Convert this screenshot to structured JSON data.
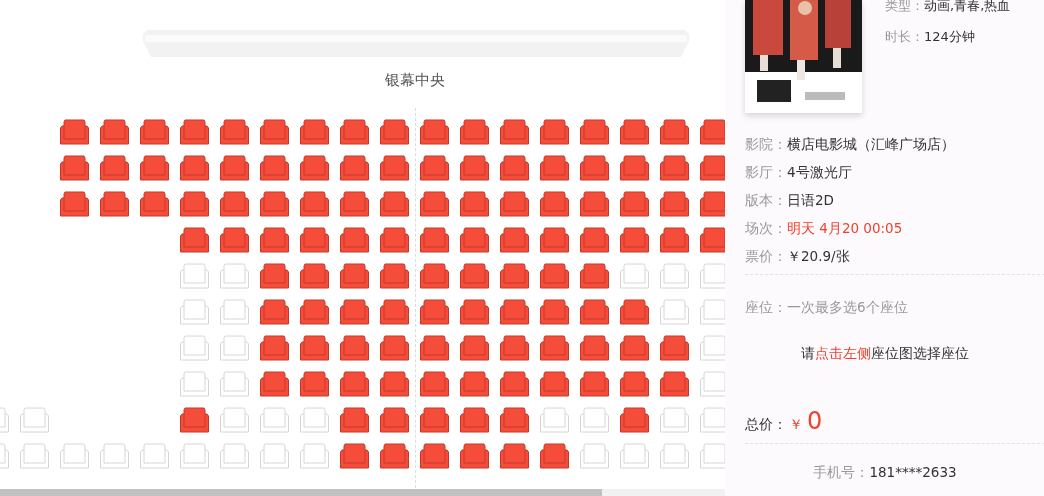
{
  "hall": {
    "screen_label": "银幕中央",
    "rows": [
      {
        "seats": [
          {
            "kind": "gap"
          },
          {
            "kind": "gap"
          },
          {
            "kind": "seat",
            "sold": true
          },
          {
            "kind": "seat",
            "sold": true
          },
          {
            "kind": "seat",
            "sold": true
          },
          {
            "kind": "seat",
            "sold": true
          },
          {
            "kind": "seat",
            "sold": true
          },
          {
            "kind": "seat",
            "sold": true
          },
          {
            "kind": "seat",
            "sold": true
          },
          {
            "kind": "seat",
            "sold": true
          },
          {
            "kind": "seat",
            "sold": true
          },
          {
            "kind": "seat",
            "sold": true
          },
          {
            "kind": "seat",
            "sold": true
          },
          {
            "kind": "seat",
            "sold": true
          },
          {
            "kind": "seat",
            "sold": true
          },
          {
            "kind": "seat",
            "sold": true
          },
          {
            "kind": "seat",
            "sold": true
          },
          {
            "kind": "seat",
            "sold": true
          },
          {
            "kind": "seat",
            "sold": true
          }
        ]
      },
      {
        "seats": [
          {
            "kind": "gap"
          },
          {
            "kind": "gap"
          },
          {
            "kind": "seat",
            "sold": true
          },
          {
            "kind": "seat",
            "sold": true
          },
          {
            "kind": "seat",
            "sold": true
          },
          {
            "kind": "seat",
            "sold": true
          },
          {
            "kind": "seat",
            "sold": true
          },
          {
            "kind": "seat",
            "sold": true
          },
          {
            "kind": "seat",
            "sold": true
          },
          {
            "kind": "seat",
            "sold": true
          },
          {
            "kind": "seat",
            "sold": true
          },
          {
            "kind": "seat",
            "sold": true
          },
          {
            "kind": "seat",
            "sold": true
          },
          {
            "kind": "seat",
            "sold": true
          },
          {
            "kind": "seat",
            "sold": true
          },
          {
            "kind": "seat",
            "sold": true
          },
          {
            "kind": "seat",
            "sold": true
          },
          {
            "kind": "seat",
            "sold": true
          },
          {
            "kind": "seat",
            "sold": true
          }
        ]
      },
      {
        "seats": [
          {
            "kind": "gap"
          },
          {
            "kind": "gap"
          },
          {
            "kind": "seat",
            "sold": true
          },
          {
            "kind": "seat",
            "sold": true
          },
          {
            "kind": "seat",
            "sold": true
          },
          {
            "kind": "seat",
            "sold": true
          },
          {
            "kind": "seat",
            "sold": true
          },
          {
            "kind": "seat",
            "sold": true
          },
          {
            "kind": "seat",
            "sold": true
          },
          {
            "kind": "seat",
            "sold": true
          },
          {
            "kind": "seat",
            "sold": true
          },
          {
            "kind": "seat",
            "sold": true
          },
          {
            "kind": "seat",
            "sold": true
          },
          {
            "kind": "seat",
            "sold": true
          },
          {
            "kind": "seat",
            "sold": true
          },
          {
            "kind": "seat",
            "sold": true
          },
          {
            "kind": "seat",
            "sold": true
          },
          {
            "kind": "seat",
            "sold": true
          },
          {
            "kind": "seat",
            "sold": true
          }
        ]
      },
      {
        "seats": [
          {
            "kind": "gap"
          },
          {
            "kind": "gap"
          },
          {
            "kind": "gap"
          },
          {
            "kind": "gap"
          },
          {
            "kind": "gap"
          },
          {
            "kind": "seat",
            "sold": true
          },
          {
            "kind": "seat",
            "sold": true
          },
          {
            "kind": "seat",
            "sold": true
          },
          {
            "kind": "seat",
            "sold": true
          },
          {
            "kind": "seat",
            "sold": true
          },
          {
            "kind": "seat",
            "sold": true
          },
          {
            "kind": "seat",
            "sold": true
          },
          {
            "kind": "seat",
            "sold": true
          },
          {
            "kind": "seat",
            "sold": true
          },
          {
            "kind": "seat",
            "sold": true
          },
          {
            "kind": "seat",
            "sold": true
          },
          {
            "kind": "seat",
            "sold": true
          },
          {
            "kind": "seat",
            "sold": true
          },
          {
            "kind": "seat",
            "sold": true
          }
        ]
      },
      {
        "seats": [
          {
            "kind": "gap"
          },
          {
            "kind": "gap"
          },
          {
            "kind": "gap"
          },
          {
            "kind": "gap"
          },
          {
            "kind": "gap"
          },
          {
            "kind": "seat",
            "sold": false
          },
          {
            "kind": "seat",
            "sold": false
          },
          {
            "kind": "seat",
            "sold": true
          },
          {
            "kind": "seat",
            "sold": true
          },
          {
            "kind": "seat",
            "sold": true
          },
          {
            "kind": "seat",
            "sold": true
          },
          {
            "kind": "seat",
            "sold": true
          },
          {
            "kind": "seat",
            "sold": true
          },
          {
            "kind": "seat",
            "sold": true
          },
          {
            "kind": "seat",
            "sold": true
          },
          {
            "kind": "seat",
            "sold": true
          },
          {
            "kind": "seat",
            "sold": false
          },
          {
            "kind": "seat",
            "sold": false
          },
          {
            "kind": "seat",
            "sold": false
          }
        ]
      },
      {
        "seats": [
          {
            "kind": "gap"
          },
          {
            "kind": "gap"
          },
          {
            "kind": "gap"
          },
          {
            "kind": "gap"
          },
          {
            "kind": "gap"
          },
          {
            "kind": "seat",
            "sold": false
          },
          {
            "kind": "seat",
            "sold": false
          },
          {
            "kind": "seat",
            "sold": true
          },
          {
            "kind": "seat",
            "sold": true
          },
          {
            "kind": "seat",
            "sold": true
          },
          {
            "kind": "seat",
            "sold": true
          },
          {
            "kind": "seat",
            "sold": true
          },
          {
            "kind": "seat",
            "sold": true
          },
          {
            "kind": "seat",
            "sold": true
          },
          {
            "kind": "seat",
            "sold": true
          },
          {
            "kind": "seat",
            "sold": true
          },
          {
            "kind": "seat",
            "sold": true
          },
          {
            "kind": "seat",
            "sold": false
          },
          {
            "kind": "seat",
            "sold": false
          }
        ]
      },
      {
        "seats": [
          {
            "kind": "gap"
          },
          {
            "kind": "gap"
          },
          {
            "kind": "gap"
          },
          {
            "kind": "gap"
          },
          {
            "kind": "gap"
          },
          {
            "kind": "seat",
            "sold": false
          },
          {
            "kind": "seat",
            "sold": false
          },
          {
            "kind": "seat",
            "sold": true
          },
          {
            "kind": "seat",
            "sold": true
          },
          {
            "kind": "seat",
            "sold": true
          },
          {
            "kind": "seat",
            "sold": true
          },
          {
            "kind": "seat",
            "sold": true
          },
          {
            "kind": "seat",
            "sold": true
          },
          {
            "kind": "seat",
            "sold": true
          },
          {
            "kind": "seat",
            "sold": true
          },
          {
            "kind": "seat",
            "sold": true
          },
          {
            "kind": "seat",
            "sold": true
          },
          {
            "kind": "seat",
            "sold": true
          },
          {
            "kind": "seat",
            "sold": false
          }
        ]
      },
      {
        "seats": [
          {
            "kind": "gap"
          },
          {
            "kind": "gap"
          },
          {
            "kind": "gap"
          },
          {
            "kind": "gap"
          },
          {
            "kind": "gap"
          },
          {
            "kind": "seat",
            "sold": false
          },
          {
            "kind": "seat",
            "sold": false
          },
          {
            "kind": "seat",
            "sold": true
          },
          {
            "kind": "seat",
            "sold": true
          },
          {
            "kind": "seat",
            "sold": true
          },
          {
            "kind": "seat",
            "sold": true
          },
          {
            "kind": "seat",
            "sold": true
          },
          {
            "kind": "seat",
            "sold": true
          },
          {
            "kind": "seat",
            "sold": true
          },
          {
            "kind": "seat",
            "sold": true
          },
          {
            "kind": "seat",
            "sold": true
          },
          {
            "kind": "seat",
            "sold": true
          },
          {
            "kind": "seat",
            "sold": true
          },
          {
            "kind": "seat",
            "sold": false
          }
        ]
      },
      {
        "seats": [
          {
            "kind": "seat",
            "sold": false
          },
          {
            "kind": "seat",
            "sold": false
          },
          {
            "kind": "gap"
          },
          {
            "kind": "gap"
          },
          {
            "kind": "gap"
          },
          {
            "kind": "seat",
            "sold": true
          },
          {
            "kind": "seat",
            "sold": false
          },
          {
            "kind": "seat",
            "sold": false
          },
          {
            "kind": "seat",
            "sold": false
          },
          {
            "kind": "seat",
            "sold": true
          },
          {
            "kind": "seat",
            "sold": true
          },
          {
            "kind": "seat",
            "sold": true
          },
          {
            "kind": "seat",
            "sold": true
          },
          {
            "kind": "seat",
            "sold": true
          },
          {
            "kind": "seat",
            "sold": false
          },
          {
            "kind": "seat",
            "sold": false
          },
          {
            "kind": "seat",
            "sold": true
          },
          {
            "kind": "seat",
            "sold": false
          },
          {
            "kind": "seat",
            "sold": false
          }
        ]
      },
      {
        "seats": [
          {
            "kind": "seat",
            "sold": false
          },
          {
            "kind": "seat",
            "sold": false
          },
          {
            "kind": "seat",
            "sold": false
          },
          {
            "kind": "seat",
            "sold": false
          },
          {
            "kind": "seat",
            "sold": false
          },
          {
            "kind": "seat",
            "sold": false
          },
          {
            "kind": "seat",
            "sold": false
          },
          {
            "kind": "seat",
            "sold": false
          },
          {
            "kind": "seat",
            "sold": false
          },
          {
            "kind": "seat",
            "sold": true
          },
          {
            "kind": "seat",
            "sold": true
          },
          {
            "kind": "seat",
            "sold": true
          },
          {
            "kind": "seat",
            "sold": true
          },
          {
            "kind": "seat",
            "sold": true
          },
          {
            "kind": "seat",
            "sold": true
          },
          {
            "kind": "seat",
            "sold": false
          },
          {
            "kind": "seat",
            "sold": false
          },
          {
            "kind": "seat",
            "sold": false
          },
          {
            "kind": "seat",
            "sold": false
          }
        ]
      }
    ]
  },
  "movie": {
    "info": [
      {
        "label": "类型：",
        "value": "动画,青春,热血"
      },
      {
        "label": "时长：",
        "value": "124分钟"
      }
    ]
  },
  "details": [
    {
      "label": "影院：",
      "value": "横店电影城（汇峰广场店）",
      "highlight": false
    },
    {
      "label": "影厅：",
      "value": "4号激光厅",
      "highlight": false
    },
    {
      "label": "版本：",
      "value": "日语2D",
      "highlight": false
    },
    {
      "label": "场次：",
      "value": "明天 4月20 00:05",
      "highlight": true
    },
    {
      "label": "票价：",
      "value": "￥20.9/张",
      "highlight": false
    }
  ],
  "seat_note": {
    "label": "座位：",
    "value": "一次最多选6个座位"
  },
  "prompt": {
    "before": "请",
    "link": "点击左侧",
    "after": "座位图选择座位"
  },
  "total": {
    "label": "总价：",
    "currency": "￥",
    "amount": "0"
  },
  "phone": {
    "label": "手机号：",
    "value": "181****2633"
  }
}
